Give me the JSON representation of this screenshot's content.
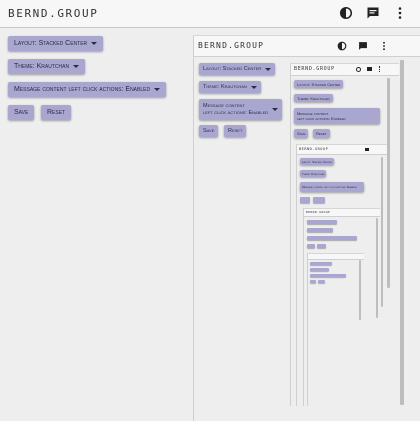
{
  "app": {
    "brand": "BERND.GROUP"
  },
  "icons": {
    "theme": "contrast-icon",
    "chat": "chat-icon",
    "menu": "more-vert-icon"
  },
  "settings": {
    "layout_label": "Layout: Stacked Center",
    "theme_label": "Theme: Krautchan",
    "message_label": "Message content left click actions: Enabled",
    "message_line1": "Message content",
    "message_line2": "left click actions: Enabled",
    "save_label": "Save",
    "reset_label": "Reset"
  },
  "colors": {
    "accent": "#a9a7cf",
    "background": "#eeeeee",
    "bar": "#f7f7f7"
  }
}
